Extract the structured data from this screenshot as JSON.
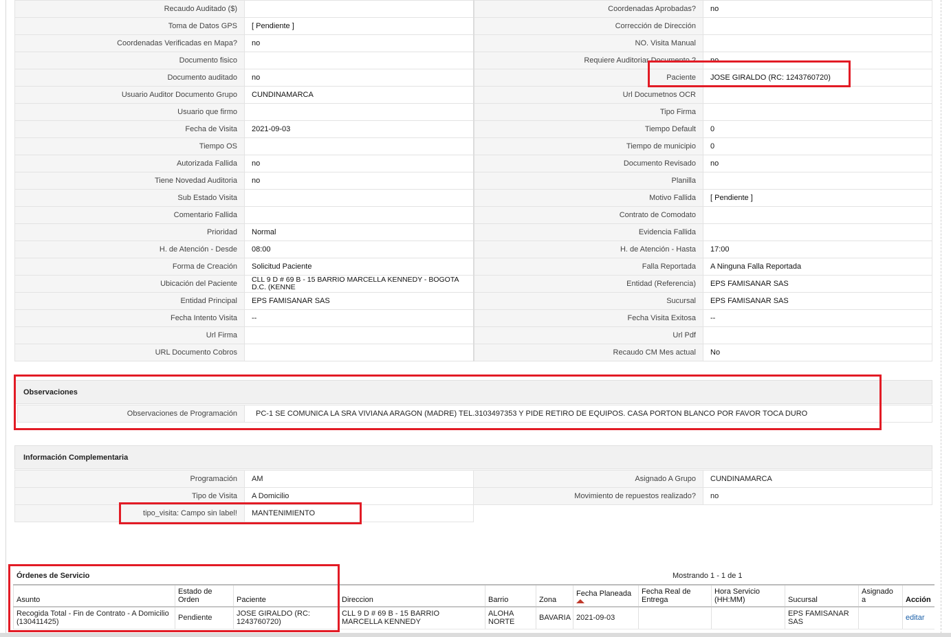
{
  "detail": {
    "rows": [
      {
        "l1": "Recaudo Auditado ($)",
        "v1": "",
        "l2": "Coordenadas Aprobadas?",
        "v2": "no"
      },
      {
        "l1": "Toma de Datos GPS",
        "v1": "[ Pendiente ]",
        "l2": "Corrección de Dirección",
        "v2": ""
      },
      {
        "l1": "Coordenadas Verificadas en Mapa?",
        "v1": "no",
        "l2": "NO. Visita Manual",
        "v2": ""
      },
      {
        "l1": "Documento fisico",
        "v1": "",
        "l2": "Requiere Auditoriar Documento ?",
        "v2": "no"
      },
      {
        "l1": "Documento auditado",
        "v1": "no",
        "l2": "Paciente",
        "v2": "JOSE GIRALDO (RC: 1243760720)"
      },
      {
        "l1": "Usuario Auditor Documento Grupo",
        "v1": "CUNDINAMARCA",
        "l2": "Url Documetnos OCR",
        "v2": ""
      },
      {
        "l1": "Usuario que firmo",
        "v1": "",
        "l2": "Tipo Firma",
        "v2": ""
      },
      {
        "l1": "Fecha de Visita",
        "v1": "2021-09-03",
        "l2": "Tiempo Default",
        "v2": "0"
      },
      {
        "l1": "Tiempo OS",
        "v1": "",
        "l2": "Tiempo de municipio",
        "v2": "0"
      },
      {
        "l1": "Autorizada Fallida",
        "v1": "no",
        "l2": "Documento Revisado",
        "v2": "no"
      },
      {
        "l1": "Tiene Novedad Auditoria",
        "v1": "no",
        "l2": "Planilla",
        "v2": ""
      },
      {
        "l1": "Sub Estado Visita",
        "v1": "",
        "l2": "Motivo Fallida",
        "v2": "[ Pendiente ]"
      },
      {
        "l1": "Comentario Fallida",
        "v1": "",
        "l2": "Contrato de Comodato",
        "v2": ""
      },
      {
        "l1": "Prioridad",
        "v1": "Normal",
        "l2": "Evidencia Fallida",
        "v2": ""
      },
      {
        "l1": "H. de Atención - Desde",
        "v1": "08:00",
        "l2": "H. de Atención - Hasta",
        "v2": "17:00"
      },
      {
        "l1": "Forma de Creación",
        "v1": "Solicitud Paciente",
        "l2": "Falla Reportada",
        "v2": "A Ninguna Falla Reportada"
      },
      {
        "l1": "Ubicación del Paciente",
        "v1": "CLL 9 D # 69 B - 15 BARRIO MARCELLA KENNEDY - BOGOTA D.C. (KENNE",
        "l2": "Entidad (Referencia)",
        "v2": "EPS FAMISANAR SAS"
      },
      {
        "l1": "Entidad Principal",
        "v1": "EPS FAMISANAR SAS",
        "l2": "Sucursal",
        "v2": "EPS FAMISANAR SAS"
      },
      {
        "l1": "Fecha Intento Visita",
        "v1": "--",
        "l2": "Fecha Visita Exitosa",
        "v2": "--"
      },
      {
        "l1": "Url Firma",
        "v1": "",
        "l2": "Url Pdf",
        "v2": ""
      },
      {
        "l1": "URL Documento Cobros",
        "v1": "",
        "l2": "Recaudo CM Mes actual",
        "v2": "No"
      }
    ]
  },
  "observaciones": {
    "title": "Observaciones",
    "label": "Observaciones de Programación",
    "value": "PC-1 SE COMUNICA LA SRA VIVIANA ARAGON (MADRE) TEL.3103497353 Y PIDE RETIRO DE EQUIPOS. CASA PORTON BLANCO POR FAVOR TOCA DURO"
  },
  "info": {
    "title": "Información Complementaria",
    "rows": [
      {
        "l1": "Programación",
        "v1": "AM",
        "l2": "Asignado A Grupo",
        "v2": "CUNDINAMARCA"
      },
      {
        "l1": "Tipo de Visita",
        "v1": "A Domicilio",
        "l2": "Movimiento de repuestos realizado?",
        "v2": "no"
      },
      {
        "l1": "tipo_visita: Campo sin label!",
        "v1": "MANTENIMIENTO"
      }
    ]
  },
  "orders": {
    "title": "Órdenes de Servicio",
    "count": "Mostrando 1 - 1 de 1",
    "headers": [
      "Asunto",
      "Estado de Orden",
      "Paciente",
      "Direccion",
      "Barrio",
      "Zona",
      "Fecha Planeada",
      "Fecha Real de Entrega",
      "Hora Servicio (HH:MM)",
      "Sucursal",
      "Asignado a",
      "Acción"
    ],
    "row": {
      "asunto": "Recogida Total - Fin de Contrato - A Domicilio (130411425)",
      "estado": "Pendiente",
      "paciente": "JOSE GIRALDO (RC: 1243760720)",
      "direccion": "CLL 9 D # 69 B - 15 BARRIO MARCELLA KENNEDY",
      "barrio": "ALOHA NORTE",
      "zona": "BAVARIA",
      "fecha_planeada": "2021-09-03",
      "fecha_real": "",
      "hora": "",
      "sucursal": "EPS FAMISANAR SAS",
      "asignado": "",
      "accion": "editar"
    }
  },
  "colors": {
    "highlight": "#e21b25",
    "link": "#1a5fa8",
    "sort_arrow": "#c0392b"
  }
}
